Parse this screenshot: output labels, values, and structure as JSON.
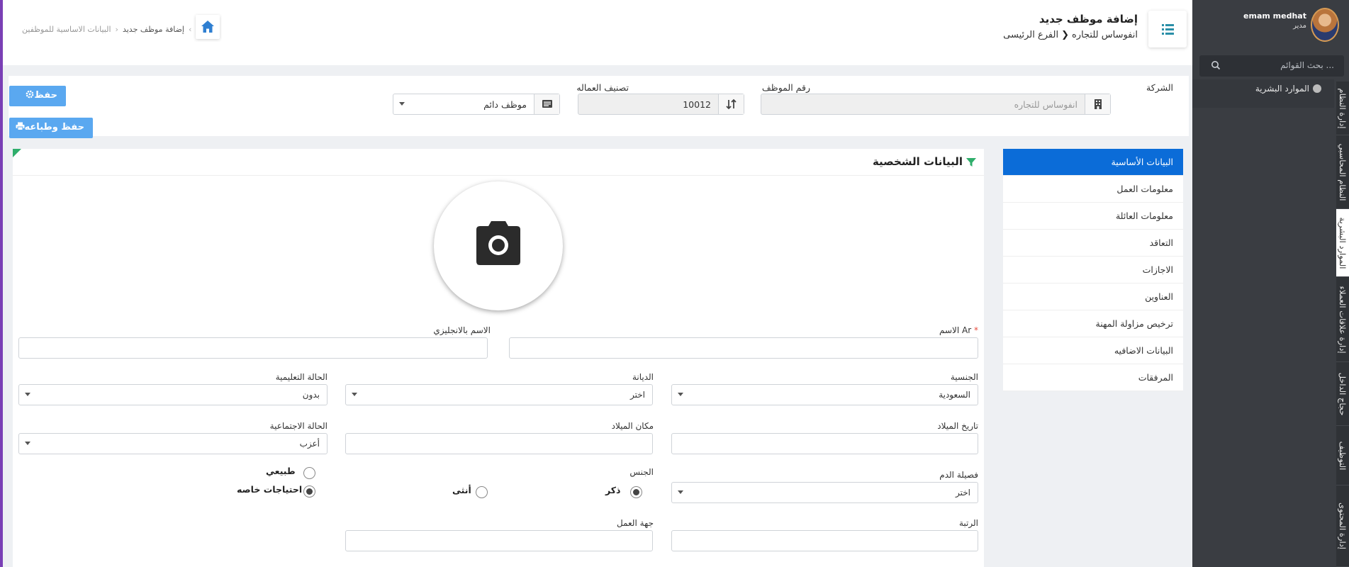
{
  "user": {
    "name": "emam medhat",
    "role": "مدير"
  },
  "sidebar": {
    "search_placeholder": "بحث القوائم ...",
    "menu_item": "الموارد البشرية",
    "vertical_tabs": [
      "إدارة النظام",
      "النظام المحاسبي",
      "الموارد البشرية",
      "إدارة علاقات العملاء",
      "حجاج الداخل",
      "التوظيف",
      "إدارة المحتوى"
    ]
  },
  "header": {
    "title": "إضافة موظف جديد",
    "company": "انفوساس للتجاره",
    "branch": "الفرع الرئيسى",
    "breadcrumb_parent": "البيانات الاساسية للموظفين",
    "breadcrumb_current": "إضافة موظف جديد"
  },
  "topform": {
    "company_label": "الشركة",
    "company_value": "انفوساس للتجاره",
    "emp_no_label": "رقم الموظف",
    "emp_no_value": "10012",
    "labor_class_label": "تصنيف العماله",
    "labor_class_value": "موظف دائم",
    "save_label": "حفظ",
    "save_print_label": "حفظ وطباعه"
  },
  "tabs": [
    "البيانات الأساسية",
    "معلومات العمل",
    "معلومات العائلة",
    "التعاقد",
    "الاجازات",
    "العناوين",
    "ترخيص مزاولة المهنة",
    "البيانات الاضافيه",
    "المرفقات"
  ],
  "panel": {
    "title": "البيانات الشخصية",
    "name_ar_label": "الاسم Ar",
    "name_en_label": "الاسم بالانجليزي",
    "nationality_label": "الجنسية",
    "nationality_value": "السعودية",
    "religion_label": "الديانة",
    "religion_value": "اختر",
    "education_label": "الحالة التعليمية",
    "education_value": "بدون",
    "birth_date_label": "تاريخ الميلاد",
    "birth_place_label": "مكان الميلاد",
    "marital_label": "الحالة الاجتماعية",
    "marital_value": "أعزب",
    "blood_label": "فصيلة الدم",
    "blood_value": "اختر",
    "gender_label": "الجنس",
    "male_label": "ذكر",
    "female_label": "أنثى",
    "normal_label": "طبيعي",
    "special_needs_label": "احتياجات خاصه",
    "rank_label": "الرتبة",
    "work_entity_label": "جهة العمل"
  }
}
